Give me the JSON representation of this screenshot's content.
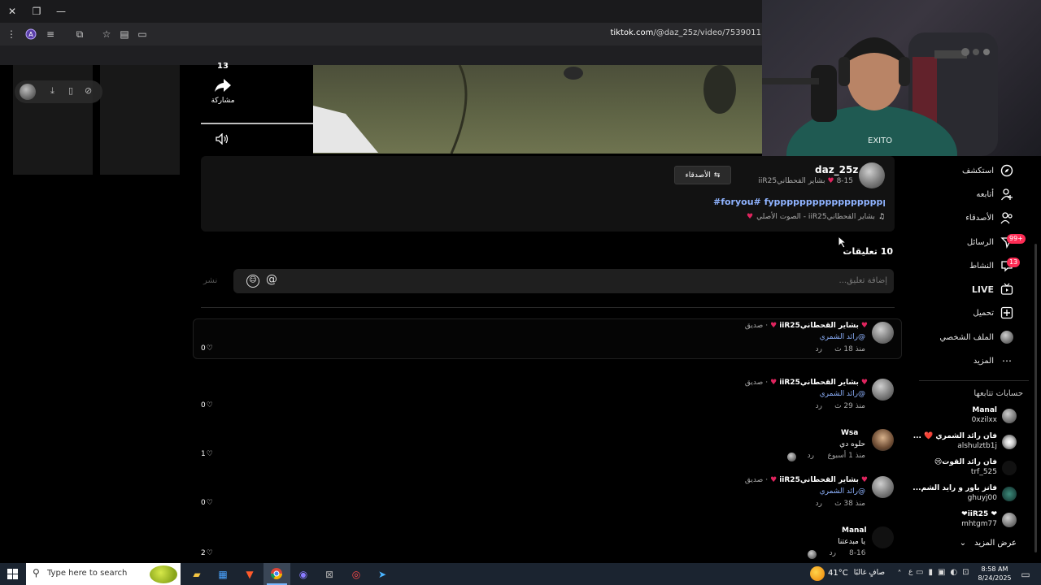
{
  "browser": {
    "url_host": "tiktok.com",
    "url_path": "/@daz_25z/video/7539011"
  },
  "video_actions": {
    "share_count": "13",
    "share_label": "مشاركة"
  },
  "author": {
    "username": "daz_25z",
    "display_name": "iiR25بشاير القحطاني",
    "date": "8-15",
    "friends_button": "الأصدقاء",
    "caption": "#foryou# fyppppppppppppppppppppppp#",
    "sound": "الصوت الأصلي - iiR25بشاير القحطاني"
  },
  "comments_section": {
    "count_label": "10 تعليقات",
    "input_placeholder": "إضافة تعليق...",
    "post_label": "نشر"
  },
  "comments": [
    {
      "name": "iiR25بشاير القحطاني",
      "tag": "صديق",
      "text": "@رائد الشمري",
      "time": "منذ 18 ث",
      "reply": "رد",
      "likes": "0"
    },
    {
      "name": "iiR25بشاير القحطاني",
      "tag": "صديق",
      "text": "@رائد الشمري",
      "time": "منذ 29 ث",
      "reply": "رد",
      "likes": "0"
    },
    {
      "name": "Wsa",
      "tag": "",
      "text": "حلوه دي",
      "time": "منذ 1 أسبوع",
      "reply": "رد",
      "likes": "1"
    },
    {
      "name": "iiR25بشاير القحطاني",
      "tag": "صديق",
      "text": "@رائد الشمري",
      "time": "منذ 38 ث",
      "reply": "رد",
      "likes": "0"
    },
    {
      "name": "Manal",
      "tag": "",
      "text": "يا مبدعتنا",
      "time": "8-16",
      "reply": "رد",
      "likes": "2"
    }
  ],
  "sidebar": {
    "nav": [
      {
        "label": "استكشف",
        "icon": "compass-icon"
      },
      {
        "label": "أتابعه",
        "icon": "following-icon"
      },
      {
        "label": "الأصدقاء",
        "icon": "friends-icon"
      },
      {
        "label": "الرسائل",
        "icon": "messages-icon",
        "badge": "99+"
      },
      {
        "label": "النشاط",
        "icon": "activity-icon",
        "badge": "13"
      },
      {
        "label": "LIVE",
        "icon": "live-icon"
      },
      {
        "label": "تحميل",
        "icon": "upload-icon"
      },
      {
        "label": "الملف الشخصي",
        "icon": "profile-avatar"
      },
      {
        "label": "المزيد",
        "icon": "more-icon"
      }
    ],
    "following_title": "حسابات تتابعها",
    "following": [
      {
        "name": "Manal",
        "handle": "0xzilxx"
      },
      {
        "name": "فان رائد الشمري ❤️ ...",
        "handle": "alshulztb1j"
      },
      {
        "name": "فان رائد القوت😢",
        "handle": "trf_525"
      },
      {
        "name": "فانز باور و رايد الشم...",
        "handle": "ghuyj00"
      },
      {
        "name": "❤ iiR25❤",
        "handle": "mhtgm77"
      }
    ],
    "show_more": "عرض المزيد"
  },
  "taskbar": {
    "search_placeholder": "Type here to search",
    "weather": "41°C",
    "weather_text": "صافٍ غالبًا",
    "lang": "ع",
    "time": "8:58 AM",
    "date": "8/24/2025"
  },
  "colors": {
    "accent": "#fe2c55",
    "link": "#8fb3ff"
  }
}
